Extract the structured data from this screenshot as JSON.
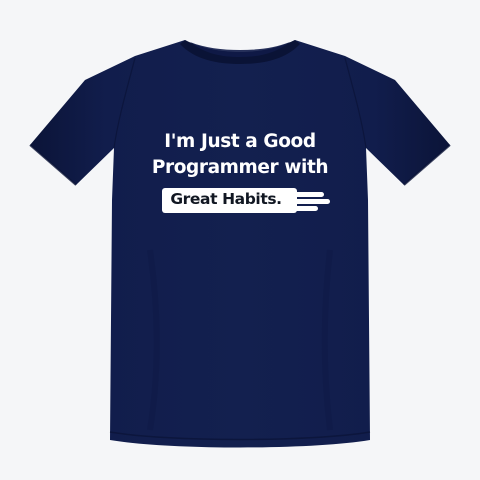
{
  "product": {
    "garment_color": "#0f1b47",
    "background_color": "#f5f6f8",
    "print_color": "#ffffff",
    "print_lines": [
      "I'm Just a Good",
      "Programmer with"
    ],
    "highlight_text": "Great Habits.",
    "highlight_text_color": "#111722",
    "decoration": "speed-lines"
  }
}
